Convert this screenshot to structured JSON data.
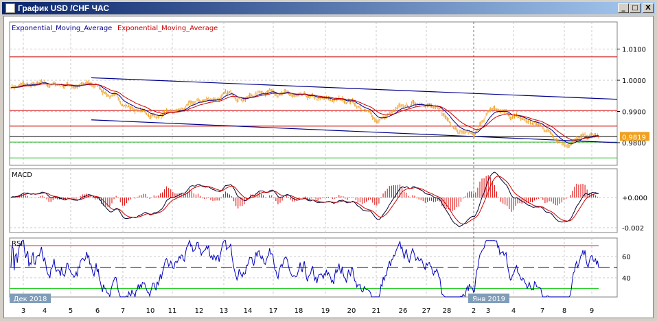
{
  "window": {
    "title": "График USD /CHF  ЧАС",
    "buttons": {
      "minimize": "_",
      "maximize": "□",
      "close": "X"
    }
  },
  "main_panel": {
    "legend": [
      {
        "text": "Exponential_Moving_Average",
        "color": "#00008b"
      },
      {
        "text": "Exponential_Moving_Average",
        "color": "#cc0000"
      }
    ],
    "y_ticks": [
      "1.0100",
      "1.0000",
      "0.9900",
      "0.9800"
    ],
    "y_tick_values": [
      1.01,
      1.0,
      0.99,
      0.98
    ],
    "current_price": "0.9819",
    "price_color": "#f0a020"
  },
  "macd_panel": {
    "label": "MACD",
    "y_ticks": [
      "+0.000",
      "-0.002"
    ],
    "y_tick_values": [
      0,
      -0.002
    ]
  },
  "rsi_panel": {
    "label": "RSI",
    "y_ticks": [
      "60",
      "40"
    ],
    "y_tick_values": [
      60,
      40
    ],
    "overbought": 70,
    "oversold": 30,
    "midline": 50
  },
  "time_axis": {
    "period_labels": [
      {
        "text": "Дек 2018",
        "at": 0
      },
      {
        "text": "Янв 2019",
        "at": 18
      }
    ],
    "day_labels": [
      "3",
      "4",
      "5",
      "6",
      "7",
      "10",
      "11",
      "12",
      "13",
      "14",
      "17",
      "18",
      "19",
      "20",
      "21",
      "26",
      "27",
      "28",
      "2",
      "3",
      "4",
      "7",
      "8",
      "9"
    ]
  },
  "chart_data": {
    "type": "line",
    "title": "График USD /CHF  ЧАС",
    "series": [
      {
        "name": "USD/CHF",
        "daily_approx": [
          0.9982,
          0.998,
          0.9987,
          0.998,
          0.9927,
          0.9888,
          0.9888,
          0.9927,
          0.995,
          0.995,
          0.9976,
          0.9938,
          0.9927,
          0.9938,
          0.9872,
          0.9905,
          0.9938,
          0.9872,
          0.9829,
          0.9895,
          0.9879,
          0.985,
          0.9806,
          0.9818
        ],
        "last": 0.9819
      }
    ],
    "horizontal_lines": [
      {
        "price": 1.0075,
        "color": "#cc0000"
      },
      {
        "price": 0.9903,
        "color": "#cc0000"
      },
      {
        "price": 0.9853,
        "color": "#cc0000"
      },
      {
        "price": 0.982,
        "color": "#000000"
      },
      {
        "price": 0.9802,
        "color": "#22bb22"
      },
      {
        "price": 0.9751,
        "color": "#22bb22"
      }
    ],
    "trendlines": [
      {
        "from": {
          "day": "6",
          "price": 1.0008
        },
        "to": {
          "day": "end",
          "price": 0.9939
        },
        "color": "#00008b"
      },
      {
        "from": {
          "day": "6",
          "price": 0.9873
        },
        "to": {
          "day": "end",
          "price": 0.98
        },
        "color": "#00008b"
      }
    ],
    "ylim": [
      0.973,
      1.0125
    ]
  }
}
